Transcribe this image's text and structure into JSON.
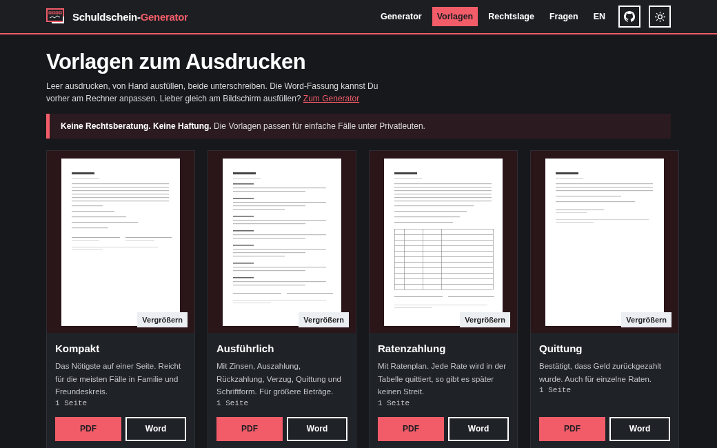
{
  "header": {
    "brand": "Schuldschein-",
    "brand_accent": "Generator",
    "nav": [
      {
        "label": "Generator",
        "selected": false
      },
      {
        "label": "Vorlagen",
        "selected": true
      },
      {
        "label": "Rechtslage",
        "selected": false
      },
      {
        "label": "Fragen",
        "selected": false
      },
      {
        "label": "EN",
        "selected": false
      }
    ]
  },
  "intro": {
    "title": "Vorlagen zum Ausdrucken",
    "text": "Leer ausdrucken, von Hand ausfüllen, beide unterschreiben. Die Word-Fassung kannst Du vorher am Rechner anpassen. Lieber gleich am Bildschirm ausfüllen?",
    "link": "Zum Generator"
  },
  "notice": {
    "strong": "Keine Rechtsberatung. Keine Haftung.",
    "text": "Die Vorlagen passen für einfache Fälle unter Privatleuten."
  },
  "templates": [
    {
      "kind": "short",
      "zoom": "Vergrößern",
      "title": "Kompakt",
      "description": "Das Nötigste auf einer Seite. Reicht für die meisten Fälle in Familie und Freundeskreis.",
      "pages": "1 Seite",
      "buttons": [
        "PDF",
        "Word"
      ]
    },
    {
      "kind": "long",
      "zoom": "Vergrößern",
      "title": "Ausführlich",
      "description": "Mit Zinsen, Auszahlung, Rückzahlung, Verzug, Quittung und Schriftform. Für größere Beträge.",
      "pages": "1 Seite",
      "buttons": [
        "PDF",
        "Word"
      ]
    },
    {
      "kind": "table",
      "zoom": "Vergrößern",
      "title": "Ratenzahlung",
      "description": "Mit Ratenplan. Jede Rate wird in der Tabelle quittiert, so gibt es später keinen Streit.",
      "pages": "1 Seite",
      "buttons": [
        "PDF",
        "Word"
      ]
    },
    {
      "kind": "receipt",
      "zoom": "Vergrößern",
      "title": "Quittung",
      "description": "Bestätigt, dass Geld zurückgezahlt wurde. Auch für einzelne Raten.",
      "pages": "1 Seite",
      "buttons": [
        "PDF",
        "Word"
      ]
    }
  ]
}
